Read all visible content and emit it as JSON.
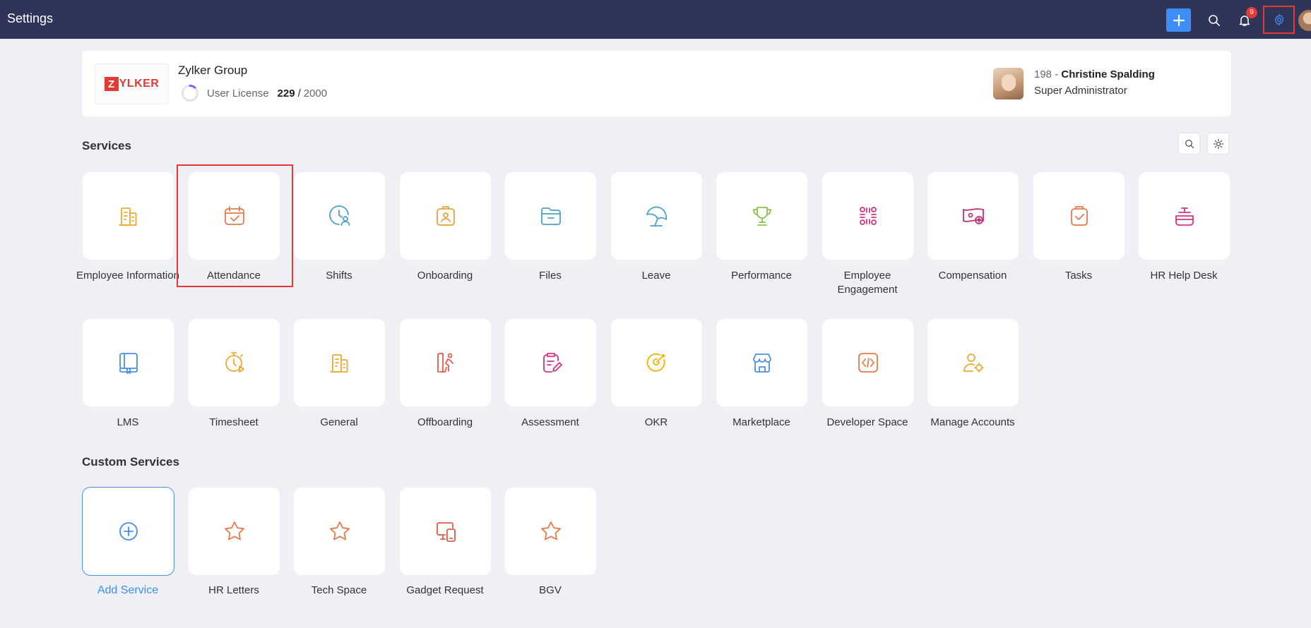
{
  "header": {
    "title": "Settings",
    "notification_count": "9"
  },
  "org": {
    "logo_z": "Z",
    "logo_rest": "YLKER",
    "name": "Zylker Group",
    "license_label": "User License",
    "license_used": "229",
    "license_total": "2000",
    "license_used_fraction": 0.1145
  },
  "admin": {
    "id_prefix": "198 - ",
    "name": "Christine Spalding",
    "role": "Super Administrator"
  },
  "services_title": "Services",
  "custom_services_title": "Custom Services",
  "services": [
    {
      "label": "Employee Information",
      "icon": "building-icon",
      "color": "#f0a830"
    },
    {
      "label": "Attendance",
      "icon": "calendar-check-icon",
      "color": "#e8794a"
    },
    {
      "label": "Shifts",
      "icon": "clock-user-icon",
      "color": "#4aa3c8"
    },
    {
      "label": "Onboarding",
      "icon": "badge-id-icon",
      "color": "#e8a23a"
    },
    {
      "label": "Files",
      "icon": "folder-icon",
      "color": "#4aa3c8"
    },
    {
      "label": "Leave",
      "icon": "beach-umbrella-icon",
      "color": "#4aa3c8"
    },
    {
      "label": "Performance",
      "icon": "trophy-icon",
      "color": "#8bc34a"
    },
    {
      "label": "Employee Engagement",
      "icon": "engagement-icon",
      "color": "#d63384"
    },
    {
      "label": "Compensation",
      "icon": "money-icon",
      "color": "#c2307a"
    },
    {
      "label": "Tasks",
      "icon": "clipboard-check-icon",
      "color": "#e8794a"
    },
    {
      "label": "HR Help Desk",
      "icon": "help-desk-icon",
      "color": "#d63384"
    },
    {
      "label": "LMS",
      "icon": "book-icon",
      "color": "#4a90e2"
    },
    {
      "label": "Timesheet",
      "icon": "stopwatch-icon",
      "color": "#f0a830"
    },
    {
      "label": "General",
      "icon": "building-icon",
      "color": "#f0a830"
    },
    {
      "label": "Offboarding",
      "icon": "exit-person-icon",
      "color": "#e05a4a"
    },
    {
      "label": "Assessment",
      "icon": "clipboard-edit-icon",
      "color": "#d63384"
    },
    {
      "label": "OKR",
      "icon": "target-icon",
      "color": "#f0b400"
    },
    {
      "label": "Marketplace",
      "icon": "store-icon",
      "color": "#4a90e2"
    },
    {
      "label": "Developer Space",
      "icon": "code-icon",
      "color": "#e8794a"
    },
    {
      "label": "Manage Accounts",
      "icon": "user-gear-icon",
      "color": "#f0a830"
    }
  ],
  "custom_services": [
    {
      "label": "Add Service",
      "icon": "plus-circle-icon",
      "color": "#3e8ef7"
    },
    {
      "label": "HR Letters",
      "icon": "star-icon",
      "color": "#e8794a"
    },
    {
      "label": "Tech Space",
      "icon": "star-icon",
      "color": "#e8794a"
    },
    {
      "label": "Gadget Request",
      "icon": "devices-icon",
      "color": "#e05a4a"
    },
    {
      "label": "BGV",
      "icon": "star-icon",
      "color": "#e8794a"
    }
  ]
}
